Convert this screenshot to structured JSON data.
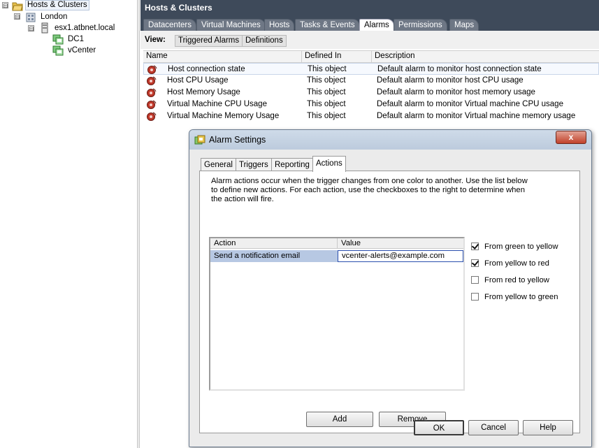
{
  "tree": {
    "items": [
      {
        "label": "Hosts & Clusters",
        "expander": "⊟"
      },
      {
        "label": "London",
        "expander": "⊟"
      },
      {
        "label": "esx1.atbnet.local",
        "expander": "⊟"
      },
      {
        "label": "DC1"
      },
      {
        "label": "vCenter"
      }
    ]
  },
  "panel": {
    "title": "Hosts & Clusters",
    "tabs": [
      "Datacenters",
      "Virtual Machines",
      "Hosts",
      "Tasks & Events",
      "Alarms",
      "Permissions",
      "Maps"
    ],
    "active_tab": "Alarms",
    "view_label": "View:",
    "view_buttons": [
      "Triggered Alarms",
      "Definitions"
    ],
    "columns": [
      "Name",
      "Defined In",
      "Description"
    ],
    "rows": [
      {
        "name": "Host connection state",
        "defined_in": "This object",
        "description": "Default alarm to monitor host connection state"
      },
      {
        "name": "Host CPU Usage",
        "defined_in": "This object",
        "description": "Default alarm to monitor host CPU usage"
      },
      {
        "name": "Host Memory Usage",
        "defined_in": "This object",
        "description": "Default alarm to monitor host memory usage"
      },
      {
        "name": "Virtual Machine CPU Usage",
        "defined_in": "This object",
        "description": "Default alarm to monitor Virtual machine CPU usage"
      },
      {
        "name": "Virtual Machine Memory Usage",
        "defined_in": "This object",
        "description": "Default alarm to monitor Virtual machine memory usage"
      }
    ]
  },
  "dialog": {
    "title": "Alarm Settings",
    "close": "x",
    "tabs": [
      "General",
      "Triggers",
      "Reporting",
      "Actions"
    ],
    "active_tab": "Actions",
    "description": "Alarm actions occur when the trigger changes from one color to another. Use the list below to define new actions. For each action, use the checkboxes to the right to determine when the action will fire.",
    "grid_columns": [
      "Action",
      "Value"
    ],
    "grid_rows": [
      {
        "action": "Send a notification email",
        "value": "vcenter-alerts@example.com"
      }
    ],
    "transitions": [
      {
        "label": "From green to yellow",
        "checked": true
      },
      {
        "label": "From yellow to red",
        "checked": true
      },
      {
        "label": "From red to yellow",
        "checked": false
      },
      {
        "label": "From yellow to green",
        "checked": false
      }
    ],
    "add_label": "Add",
    "remove_label": "Remove",
    "ok_label": "OK",
    "cancel_label": "Cancel",
    "help_label": "Help"
  },
  "colors": {
    "header_bg": "#3e4a5a",
    "alarm_icon": "#c0392b",
    "grid_selection": "#b7c8e3"
  }
}
